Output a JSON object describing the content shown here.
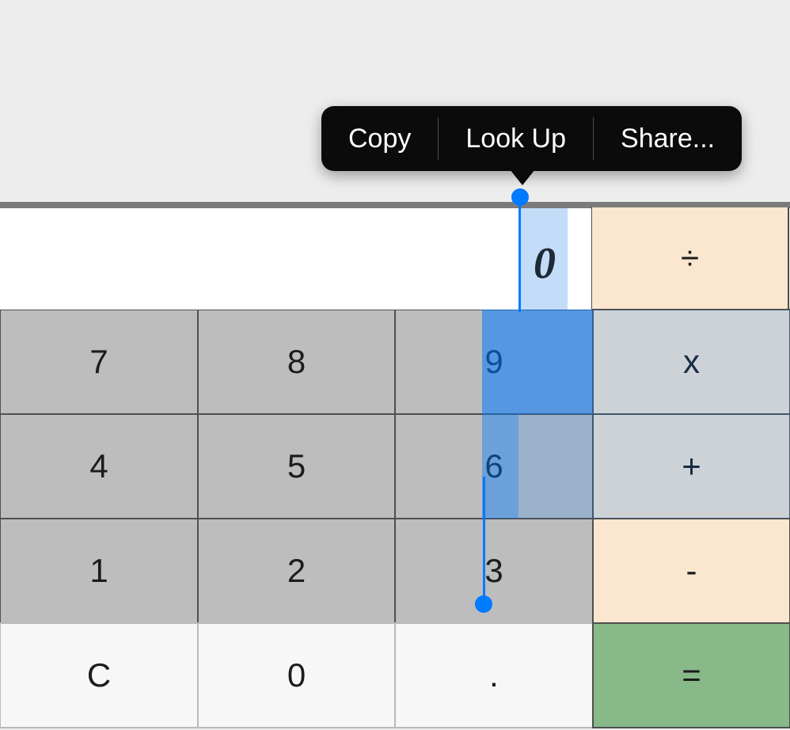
{
  "display": {
    "value": "0"
  },
  "context_menu": {
    "items": [
      "Copy",
      "Look Up",
      "Share..."
    ]
  },
  "keys": {
    "row1": [
      "7",
      "8",
      "9",
      "x"
    ],
    "row2": [
      "4",
      "5",
      "6",
      "+"
    ],
    "row3": [
      "1",
      "2",
      "3",
      "-"
    ],
    "row4": [
      "C",
      "0",
      ".",
      "="
    ]
  },
  "op_divide": "÷"
}
